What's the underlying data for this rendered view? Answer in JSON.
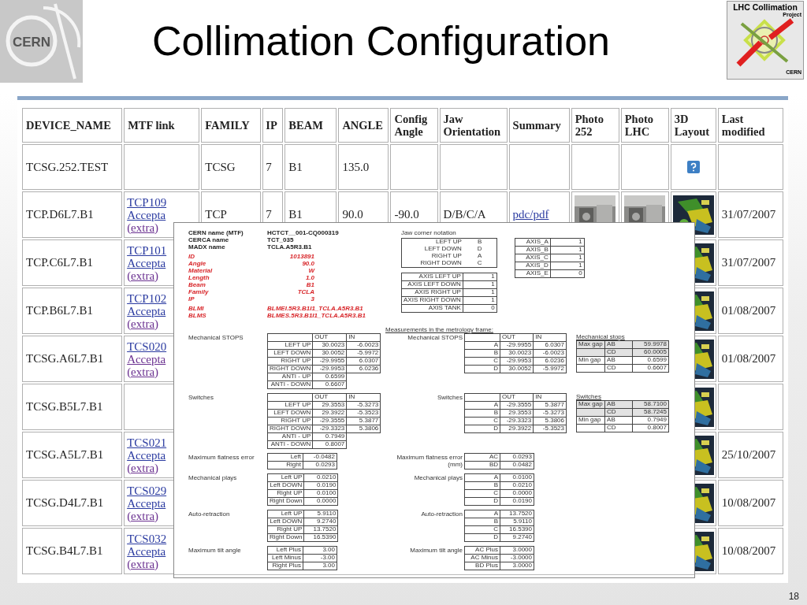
{
  "slide": {
    "title": "Collimation Configuration",
    "number": "18"
  },
  "logo_left": {
    "text": "CERN"
  },
  "logo_right": {
    "title": "LHC Collimation",
    "subtitle": "Project",
    "footer": "CERN"
  },
  "table": {
    "columns": [
      "DEVICE_NAME",
      "MTF link",
      "FAMILY",
      "IP",
      "BEAM",
      "ANGLE",
      "Config Angle",
      "Jaw Orientation",
      "Summary",
      "Photo 252",
      "Photo LHC",
      "3D Layout",
      "Last modified"
    ],
    "rows": [
      {
        "device_name": "TCSG.252.TEST",
        "family": "TCSG",
        "ip": "7",
        "beam": "B1",
        "angle": "135.0",
        "layout_3d": {
          "kind": "help"
        }
      },
      {
        "device_name": "TCP.D6L7.B1",
        "mtf_links": [
          {
            "text": "TCP109",
            "visited": false
          },
          {
            "text": "Accepta",
            "visited": false
          },
          {
            "text": "(extra)",
            "visited": true
          }
        ],
        "family": "TCP",
        "ip": "7",
        "beam": "B1",
        "angle": "90.0",
        "config_angle": "-90.0",
        "jaw_orientation": "D/B/C/A",
        "summary": "pdc/pdf",
        "photo_252": {
          "kind": "picture"
        },
        "photo_lhc": {
          "kind": "picture"
        },
        "layout_3d": {
          "kind": "picture"
        },
        "last_modified": "31/07/2007"
      },
      {
        "device_name": "TCP.C6L7.B1",
        "mtf_links": [
          {
            "text": "TCP101",
            "visited": false
          },
          {
            "text": "Accepta",
            "visited": false
          },
          {
            "text": "(extra)",
            "visited": true
          }
        ],
        "layout_3d": {
          "kind": "picture"
        },
        "last_modified": "31/07/2007"
      },
      {
        "device_name": "TCP.B6L7.B1",
        "mtf_links": [
          {
            "text": "TCP102",
            "visited": false
          },
          {
            "text": "Accepta",
            "visited": false
          },
          {
            "text": "(extra)",
            "visited": true
          }
        ],
        "layout_3d": {
          "kind": "picture"
        },
        "last_modified": "01/08/2007"
      },
      {
        "device_name": "TCSG.A6L7.B1",
        "mtf_links": [
          {
            "text": "TCS020",
            "visited": false
          },
          {
            "text": "Accepta",
            "visited": true
          },
          {
            "text": "(extra)",
            "visited": true
          }
        ],
        "layout_3d": {
          "kind": "picture"
        },
        "last_modified": "01/08/2007"
      },
      {
        "device_name": "TCSG.B5L7.B1",
        "layout_3d": {
          "kind": "picture"
        }
      },
      {
        "device_name": "TCSG.A5L7.B1",
        "mtf_links": [
          {
            "text": "TCS021",
            "visited": false
          },
          {
            "text": "Accepta",
            "visited": false
          },
          {
            "text": "(extra)",
            "visited": true
          }
        ],
        "layout_3d": {
          "kind": "picture"
        },
        "last_modified": "25/10/2007"
      },
      {
        "device_name": "TCSG.D4L7.B1",
        "mtf_links": [
          {
            "text": "TCS029",
            "visited": false
          },
          {
            "text": "Accepta",
            "visited": false
          },
          {
            "text": "(extra)",
            "visited": true
          }
        ],
        "layout_3d": {
          "kind": "picture"
        },
        "last_modified": "10/08/2007"
      },
      {
        "device_name": "TCSG.B4L7.B1",
        "mtf_links": [
          {
            "text": "TCS032",
            "visited": false
          },
          {
            "text": "Accepta",
            "visited": false
          },
          {
            "text": "(extra)",
            "visited": true
          }
        ],
        "layout_3d": {
          "kind": "picture"
        },
        "last_modified": "10/08/2007"
      }
    ]
  },
  "document": {
    "names": [
      {
        "label": "CERN name (MTF)",
        "value": "HCTCT__001-CQ000319"
      },
      {
        "label": "CERCA name",
        "value": "TCT_035"
      },
      {
        "label": "MADX name",
        "value": "TCLA.A5R3.B1"
      }
    ],
    "properties": [
      {
        "label": "ID",
        "value": "1013891"
      },
      {
        "label": "Angle",
        "value": "90.0"
      },
      {
        "label": "Material",
        "value": "W"
      },
      {
        "label": "Length",
        "value": "1.0"
      },
      {
        "label": "Beam",
        "value": "B1"
      },
      {
        "label": "Family",
        "value": "TCLA"
      },
      {
        "label": "IP",
        "value": "3"
      }
    ],
    "blm": [
      {
        "label": "BLMI",
        "value": "BLMEI.5R3.B1I1_TCLA.A5R3.B1"
      },
      {
        "label": "BLMS",
        "value": "BLMES.5R3.B1I1_TCLA.A5R3.B1"
      }
    ],
    "jaw_notation": {
      "label": "Jaw corner notation",
      "table": {
        "kind": "boxed",
        "rows": [
          {
            "name": "LEFT UP",
            "out": "B"
          },
          {
            "name": "LEFT DOWN",
            "out": "D"
          },
          {
            "name": "RIGHT UP",
            "out": "A"
          },
          {
            "name": "RIGHT DOWN",
            "out": "C"
          }
        ]
      }
    },
    "axes": {
      "kind": "grid",
      "rows": [
        {
          "name": "AXIS LEFT UP",
          "out": "1"
        },
        {
          "name": "AXIS LEFT DOWN",
          "out": "1"
        },
        {
          "name": "AXIS RIGHT UP",
          "out": "1"
        },
        {
          "name": "AXIS RIGHT DOWN",
          "out": "1"
        },
        {
          "name": "AXIS TANK",
          "out": "0"
        }
      ]
    },
    "axes_frame": {
      "kind": "grid",
      "rows": [
        {
          "name": "AXIS_A",
          "out": "1"
        },
        {
          "name": "AXIS_B",
          "out": "1"
        },
        {
          "name": "AXIS_C",
          "out": "1"
        },
        {
          "name": "AXIS_D",
          "out": "1"
        },
        {
          "name": "AXIS_E",
          "out": "0"
        }
      ]
    },
    "sections": [
      {
        "label": "Mechanical STOPS",
        "table": {
          "kind": "grid",
          "columns": [
            "OUT",
            "IN"
          ],
          "rows": [
            {
              "name": "LEFT UP",
              "out": "30.0023",
              "in": "-6.0023"
            },
            {
              "name": "LEFT DOWN",
              "out": "30.0052",
              "in": "-5.9972"
            },
            {
              "name": "RIGHT UP",
              "out": "-29.9955",
              "in": "6.0307"
            },
            {
              "name": "RIGHT DOWN",
              "out": "-29.9953",
              "in": "6.0236"
            },
            {
              "name": "ANTI - UP",
              "out": "0.6599"
            },
            {
              "name": "ANTI - DOWN",
              "out": "0.6607"
            }
          ]
        },
        "frame": {
          "heading": "Measurements in the metrology frame:",
          "label": "Mechanical STOPS",
          "table": {
            "kind": "grid",
            "columns": [
              "OUT",
              "IN"
            ],
            "rows": [
              {
                "name": "A",
                "out": "-29.9955",
                "in": "6.0307"
              },
              {
                "name": "B",
                "out": "30.0023",
                "in": "-6.0023"
              },
              {
                "name": "C",
                "out": "-29.9953",
                "in": "6.0236"
              },
              {
                "name": "D",
                "out": "30.0052",
                "in": "-5.9972"
              }
            ]
          }
        },
        "summary": {
          "title": "Mechanical stops",
          "rows": [
            {
              "group": "Max gap",
              "pair": "AB",
              "value": "59.9978",
              "shaded": true
            },
            {
              "pair": "CD",
              "value": "60.0005",
              "shaded": true
            },
            {
              "group": "Min gap",
              "pair": "AB",
              "value": "0.6599",
              "shaded": false
            },
            {
              "pair": "CD",
              "value": "0.6607",
              "shaded": false
            }
          ]
        }
      },
      {
        "label": "Switches",
        "table": {
          "kind": "grid",
          "columns": [
            "OUT",
            "IN"
          ],
          "rows": [
            {
              "name": "LEFT UP",
              "out": "29.3553",
              "in": "-5.3273"
            },
            {
              "name": "LEFT DOWN",
              "out": "29.3922",
              "in": "-5.3523"
            },
            {
              "name": "RIGHT UP",
              "out": "-29.3555",
              "in": "5.3877"
            },
            {
              "name": "RIGHT DOWN",
              "out": "-29.3323",
              "in": "5.3806"
            },
            {
              "name": "ANTI - UP",
              "out": "0.7949"
            },
            {
              "name": "ANTI - DOWN",
              "out": "0.8007"
            }
          ]
        },
        "frame": {
          "label": "Switches",
          "table": {
            "kind": "grid",
            "columns": [
              "OUT",
              "IN"
            ],
            "rows": [
              {
                "name": "A",
                "out": "-29.3555",
                "in": "5.3877"
              },
              {
                "name": "B",
                "out": "29.3553",
                "in": "-5.3273"
              },
              {
                "name": "C",
                "out": "-29.3323",
                "in": "5.3806"
              },
              {
                "name": "D",
                "out": "29.3922",
                "in": "-5.3523"
              }
            ]
          }
        },
        "summary": {
          "title": "Switches",
          "rows": [
            {
              "group": "Max gap",
              "pair": "AB",
              "value": "58.7100",
              "shaded": true
            },
            {
              "pair": "CD",
              "value": "58.7245",
              "shaded": true
            },
            {
              "group": "Min gap",
              "pair": "AB",
              "value": "0.7949",
              "shaded": false
            },
            {
              "pair": "CD",
              "value": "0.8007",
              "shaded": false
            }
          ]
        }
      },
      {
        "label": "Maximum flatness error",
        "table": {
          "kind": "grid",
          "rows": [
            {
              "name": "Left",
              "out": "-0.0482"
            },
            {
              "name": "Right",
              "out": "0.0293"
            }
          ]
        },
        "frame": {
          "label": "Maximum flatness error (mm)",
          "table": {
            "kind": "grid",
            "rows": [
              {
                "name": "AC",
                "out": "0.0293"
              },
              {
                "name": "BD",
                "out": "0.0482"
              }
            ]
          }
        }
      },
      {
        "label": "Mechanical plays",
        "table": {
          "kind": "grid",
          "rows": [
            {
              "name": "Left UP",
              "out": "0.0210"
            },
            {
              "name": "Left DOWN",
              "out": "0.0190"
            },
            {
              "name": "Right UP",
              "out": "0.0100"
            },
            {
              "name": "Right Down",
              "out": "0.0000"
            }
          ]
        },
        "frame": {
          "label": "Mechanical plays",
          "table": {
            "kind": "grid",
            "rows": [
              {
                "name": "A",
                "out": "0.0100"
              },
              {
                "name": "B",
                "out": "0.0210"
              },
              {
                "name": "C",
                "out": "0.0000"
              },
              {
                "name": "D",
                "out": "0.0190"
              }
            ]
          }
        }
      },
      {
        "label": "Auto-retraction",
        "table": {
          "kind": "grid",
          "rows": [
            {
              "name": "Left UP",
              "out": "5.9110"
            },
            {
              "name": "Left DOWN",
              "out": "9.2740"
            },
            {
              "name": "Right UP",
              "out": "13.7520"
            },
            {
              "name": "Right Down",
              "out": "16.5390"
            }
          ]
        },
        "frame": {
          "label": "Auto-retraction",
          "table": {
            "kind": "grid",
            "rows": [
              {
                "name": "A",
                "out": "13.7520"
              },
              {
                "name": "B",
                "out": "5.9110"
              },
              {
                "name": "C",
                "out": "16.5390"
              },
              {
                "name": "D",
                "out": "9.2740"
              }
            ]
          }
        }
      },
      {
        "label": "Maximum tilt angle",
        "table": {
          "kind": "grid",
          "rows": [
            {
              "name": "Left Plus",
              "out": "3.00"
            },
            {
              "name": "Left Minus",
              "out": "-3.00"
            },
            {
              "name": "Right Plus",
              "out": "3.00"
            }
          ]
        },
        "frame": {
          "label": "Maximum tilt angle",
          "table": {
            "kind": "grid",
            "rows": [
              {
                "name": "AC Plus",
                "out": "3.0000"
              },
              {
                "name": "AC Minus",
                "out": "-3.0000"
              },
              {
                "name": "BD Plus",
                "out": "3.0000"
              }
            ]
          }
        }
      }
    ]
  }
}
